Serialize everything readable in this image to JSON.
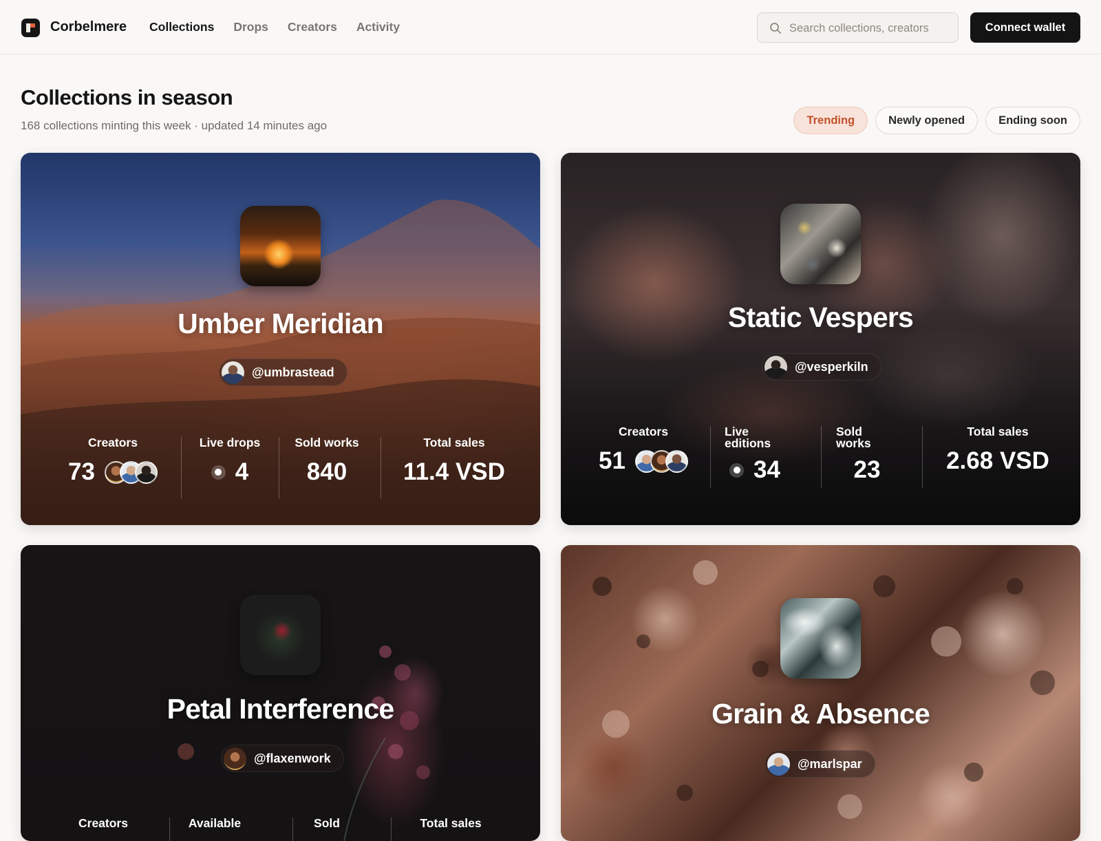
{
  "header": {
    "brand": "Corbelmere",
    "nav": [
      {
        "label": "Collections",
        "active": true
      },
      {
        "label": "Drops",
        "active": false
      },
      {
        "label": "Creators",
        "active": false
      },
      {
        "label": "Activity",
        "active": false
      }
    ],
    "search_placeholder": "Search collections, creators",
    "connect_label": "Connect wallet"
  },
  "page": {
    "title": "Collections in season",
    "subtitle": "168 collections minting this week · updated 14 minutes ago",
    "filters": [
      {
        "label": "Trending",
        "active": true
      },
      {
        "label": "Newly opened",
        "active": false
      },
      {
        "label": "Ending soon",
        "active": false
      }
    ]
  },
  "collections": [
    {
      "title": "Umber Meridian",
      "creator": "@umbrastead",
      "stats": [
        {
          "label": "Creators",
          "value": "73"
        },
        {
          "label": "Live drops",
          "value": "4"
        },
        {
          "label": "Sold works",
          "value": "840"
        },
        {
          "label": "Total sales",
          "value": "11.4 VSD"
        }
      ]
    },
    {
      "title": "Static Vespers",
      "creator": "@vesperkiln",
      "stats": [
        {
          "label": "Creators",
          "value": "51"
        },
        {
          "label": "Live editions",
          "value": "34"
        },
        {
          "label": "Sold works",
          "value": "23"
        },
        {
          "label": "Total sales",
          "value": "2.68 VSD"
        }
      ]
    },
    {
      "title": "Petal Interference",
      "creator": "@flaxenwork",
      "stats": [
        {
          "label": "Creators",
          "value": ""
        },
        {
          "label": "Available",
          "value": ""
        },
        {
          "label": "Sold",
          "value": ""
        },
        {
          "label": "Total sales",
          "value": ""
        }
      ]
    },
    {
      "title": "Grain & Absence",
      "creator": "@marlspar"
    }
  ],
  "colors": {
    "accent": "#c2512a",
    "accent_bg": "#f8e3da",
    "button_dark": "#141414",
    "page_bg": "#faf8f6"
  }
}
